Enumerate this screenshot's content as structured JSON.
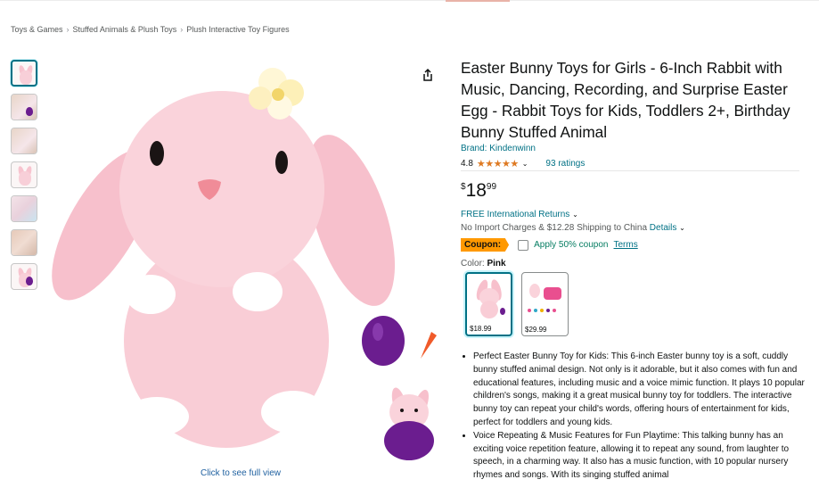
{
  "breadcrumb": [
    "Toys & Games",
    "Stuffed Animals & Plush Toys",
    "Plush Interactive Toy Figures"
  ],
  "gallery": {
    "thumbnail_count": 7,
    "full_view_link": "Click to see full view"
  },
  "product": {
    "title": "Easter Bunny Toys for Girls - 6-Inch Rabbit with Music, Dancing, Recording, and Surprise Easter Egg - Rabbit Toys for Kids, Toddlers 2+, Birthday Bunny Stuffed Animal",
    "brand": "Brand: Kindenwinn",
    "rating": "4.8",
    "stars": 4.8,
    "ratings_count": "93 ratings",
    "price": {
      "symbol": "$",
      "whole": "18",
      "fraction": "99"
    },
    "returns": "FREE International Returns",
    "shipping_text": "No Import Charges & $12.28 Shipping to China",
    "shipping_details": "Details",
    "coupon": {
      "badge": "Coupon:",
      "text": "Apply 50% coupon",
      "terms": "Terms"
    },
    "color_label": "Color:",
    "color_value": "Pink",
    "swatches": [
      {
        "price": "$18.99",
        "selected": true
      },
      {
        "price": "$29.99",
        "selected": false
      }
    ],
    "bullets": [
      "Perfect Easter Bunny Toy for Kids: This 6-inch Easter bunny toy is a soft, cuddly bunny stuffed animal design. Not only is it adorable, but it also comes with fun and educational features, including music and a voice mimic function. It plays 10 popular children's songs, making it a great musical bunny toy for toddlers. The interactive bunny toy can repeat your child's words, offering hours of entertainment for kids, perfect for toddlers and young kids.",
      "Voice Repeating & Music Features for Fun Playtime: This talking bunny has an exciting voice repetition feature, allowing it to repeat any sound, from laughter to speech, in a charming way. It also has a music function, with 10 popular nursery rhymes and songs. With its singing stuffed animal"
    ]
  },
  "colors": {
    "link": "#007185",
    "star": "#de7921",
    "coupon_badge": "#ff9900",
    "coupon_text": "#067d62",
    "bunny_pink": "#f8c8d2",
    "egg_purple": "#6b1d8f"
  }
}
